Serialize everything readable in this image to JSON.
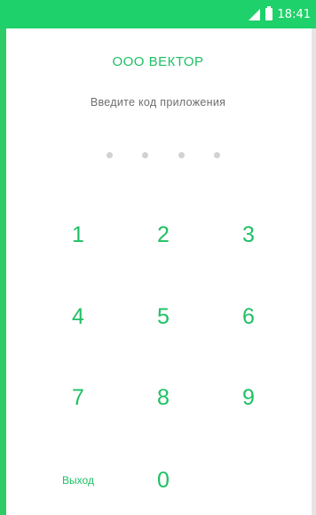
{
  "status_bar": {
    "time": "18:41",
    "icons": [
      "signal-icon",
      "battery-icon"
    ]
  },
  "header": {
    "company": "ООО ВЕКТОР",
    "prompt": "Введите код приложения"
  },
  "pin": {
    "length": 4,
    "entered": 0
  },
  "keypad": {
    "keys": [
      "1",
      "2",
      "3",
      "4",
      "5",
      "6",
      "7",
      "8",
      "9",
      "0"
    ],
    "exit_label": "Выход"
  },
  "colors": {
    "accent": "#1fc064",
    "status_bar": "#1fd16a",
    "dot_empty": "#d2d2d2"
  }
}
